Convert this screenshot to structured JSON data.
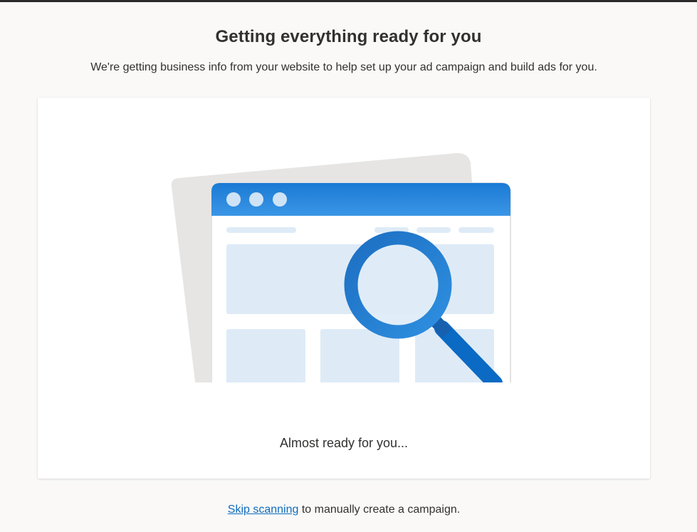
{
  "page": {
    "title": "Getting everything ready for you",
    "subtitle": "We're getting business info from your website to help set up your ad campaign and build ads for you."
  },
  "card": {
    "status_text": "Almost ready for you...",
    "illustration_icon": "website-magnifier-icon"
  },
  "footer": {
    "skip_link": "Skip scanning",
    "rest_text": " to manually create a campaign."
  },
  "colors": {
    "accent": "#0f6cbd",
    "browser_bar": "#1a7ad4",
    "placeholder_blue": "#deebf7",
    "page_background": "#faf9f8"
  }
}
